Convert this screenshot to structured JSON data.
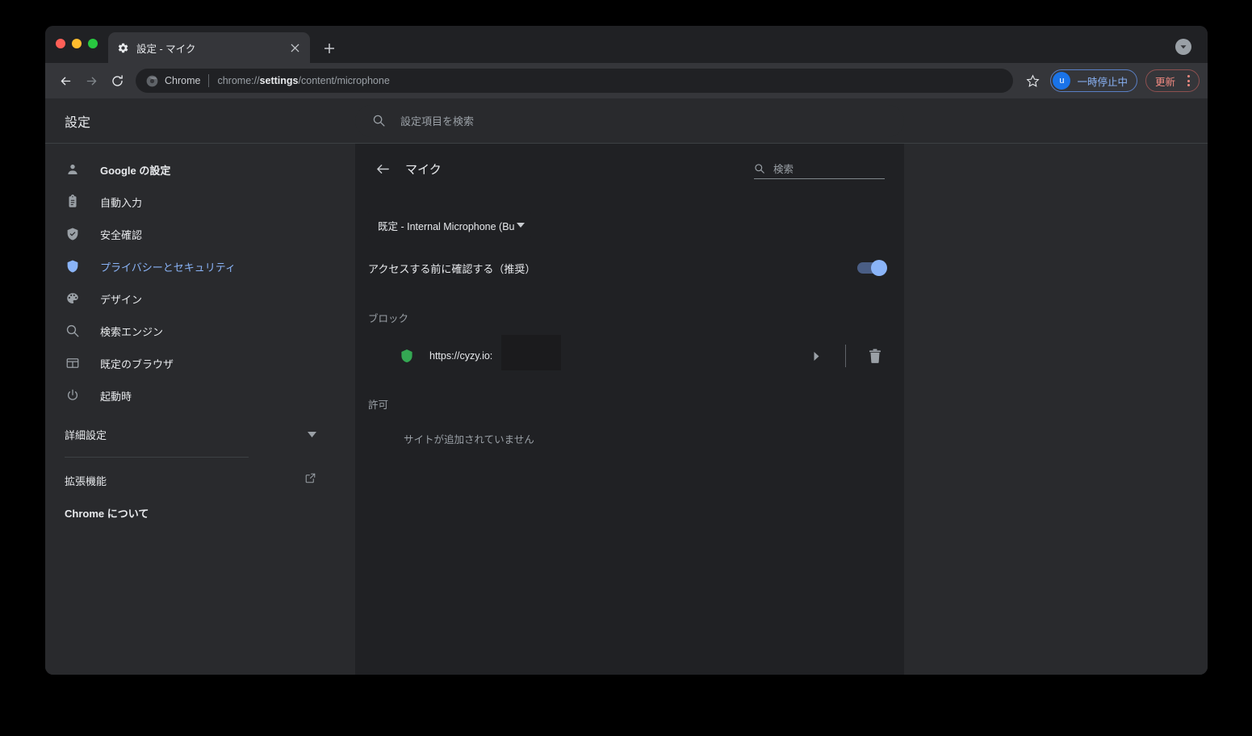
{
  "window": {
    "traffic_lights": [
      "close",
      "minimize",
      "maximize"
    ]
  },
  "tabstrip": {
    "tab": {
      "title": "設定 - マイク",
      "favicon": "gear-icon",
      "close_label": "×"
    },
    "new_tab_label": "+",
    "end_button_icon": "chevron-down-circle-icon"
  },
  "toolbar": {
    "back_label": "←",
    "forward_label": "→",
    "reload_label": "⟳",
    "omnibox": {
      "chip_icon": "chrome-icon",
      "chip_label": "Chrome",
      "url_prefix": "chrome://",
      "url_bold": "settings",
      "url_suffix": "/content/microphone",
      "full_url": "chrome://settings/content/microphone"
    },
    "star_icon": "bookmark-star-icon",
    "profile": {
      "avatar_initial": "u",
      "label": "一時停止中"
    },
    "update": {
      "label": "更新",
      "menu_icon": "kebab-menu-icon"
    }
  },
  "settings": {
    "brand": "設定",
    "search_placeholder": "設定項目を検索",
    "sidebar": {
      "items": [
        {
          "label": "Google の設定",
          "icon": "person-icon",
          "bold": true,
          "active": false
        },
        {
          "label": "自動入力",
          "icon": "clipboard-icon",
          "bold": false,
          "active": false
        },
        {
          "label": "安全確認",
          "icon": "shield-check-icon",
          "bold": false,
          "active": false
        },
        {
          "label": "プライバシーとセキュリティ",
          "icon": "shield-icon",
          "bold": false,
          "active": true
        },
        {
          "label": "デザイン",
          "icon": "palette-icon",
          "bold": false,
          "active": false
        },
        {
          "label": "検索エンジン",
          "icon": "search-icon",
          "bold": false,
          "active": false
        },
        {
          "label": "既定のブラウザ",
          "icon": "browser-window-icon",
          "bold": false,
          "active": false
        },
        {
          "label": "起動時",
          "icon": "power-icon",
          "bold": false,
          "active": false
        }
      ],
      "advanced": {
        "label": "詳細設定",
        "icon": "chevron-down-icon"
      },
      "extensions": {
        "label": "拡張機能",
        "icon": "open-in-new-icon"
      },
      "about": {
        "label": "Chrome について"
      }
    },
    "page": {
      "title": "マイク",
      "back_icon": "arrow-left-icon",
      "search_placeholder": "検索",
      "device_select": {
        "value": "既定 - Internal Microphone (Bu",
        "caret_icon": "caret-down-icon"
      },
      "ask_toggle": {
        "label": "アクセスする前に確認する（推奨）",
        "state": "on"
      },
      "block_section": {
        "title": "ブロック",
        "sites": [
          {
            "url": "https://cyzy.io:",
            "favicon": "green-shield-icon",
            "chevron_icon": "chevron-right-icon",
            "delete_icon": "trash-icon",
            "redacted": true
          }
        ]
      },
      "allow_section": {
        "title": "許可",
        "empty_text": "サイトが追加されていません"
      }
    }
  },
  "colors": {
    "window_bg": "#202124",
    "toolbar_bg": "#35363a",
    "page_bg": "#292a2d",
    "card_bg": "#202124",
    "accent_blue": "#8ab4f8",
    "update_red": "#f28b82",
    "text_primary": "#e8eaed",
    "text_secondary": "#9aa0a6"
  }
}
